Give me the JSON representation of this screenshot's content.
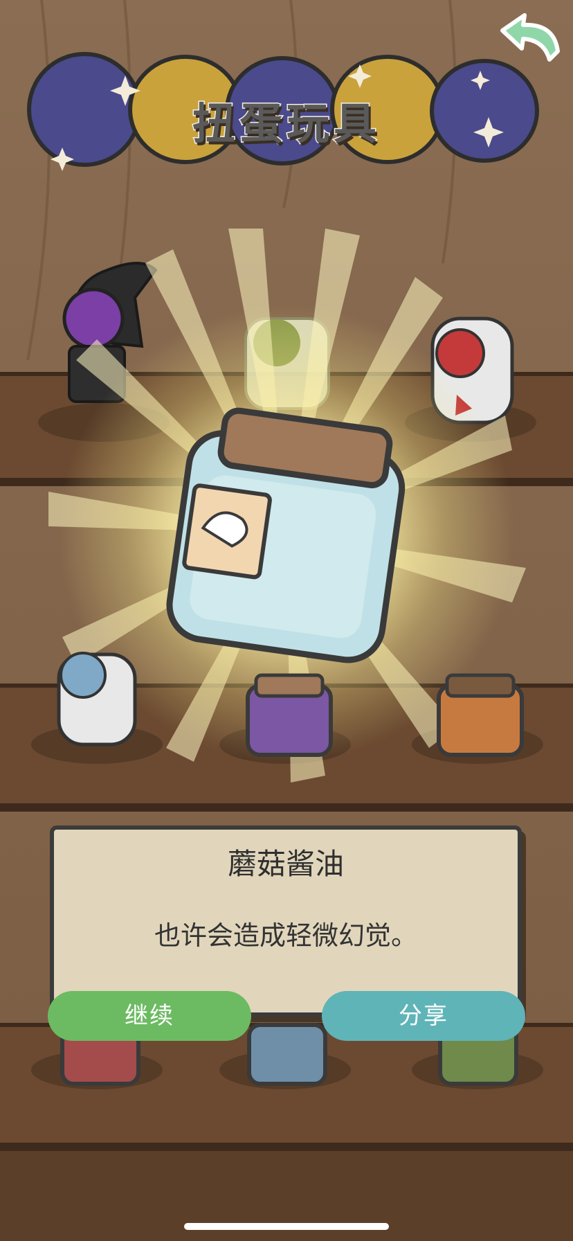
{
  "header": {
    "title": "扭蛋玩具"
  },
  "icons": {
    "back": "return-arrow-icon"
  },
  "featured_item": {
    "name": "蘑菇酱油",
    "description": "也许会造成轻微幻觉。"
  },
  "buttons": {
    "continue_label": "继续",
    "share_label": "分享"
  },
  "colors": {
    "continue": "#6cbb62",
    "share": "#5fb4b8",
    "dialog_bg": "#e1d6bc",
    "shelf": "#6b4a31"
  }
}
